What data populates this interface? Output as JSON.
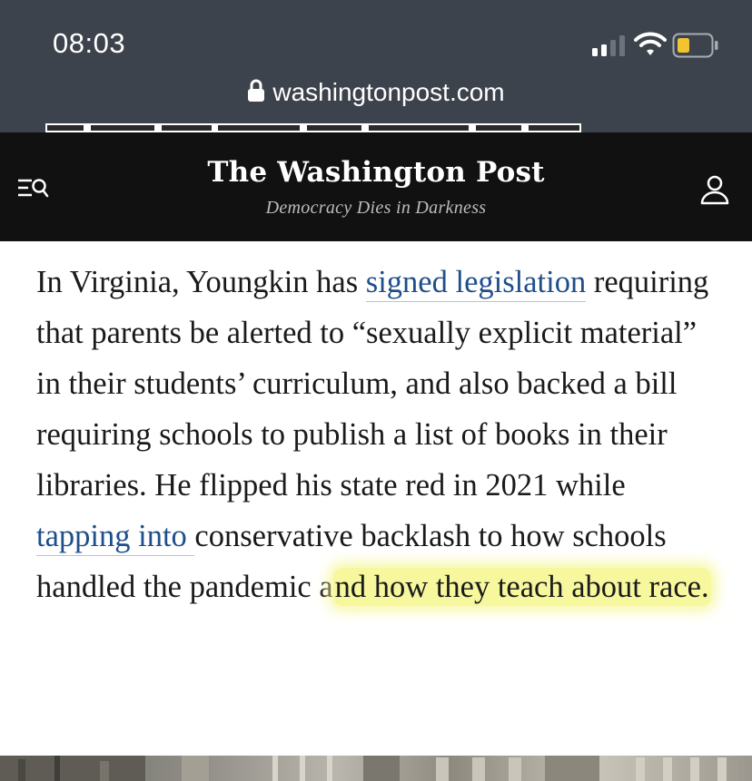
{
  "status_bar": {
    "time": "08:03",
    "signal_icon": "cellular-signal-icon",
    "wifi_icon": "wifi-icon",
    "battery_icon": "battery-low-icon",
    "battery_color": "#f4c430"
  },
  "address_bar": {
    "lock_icon": "lock-icon",
    "url": "washingtonpost.com"
  },
  "header": {
    "menu_icon": "menu-search-icon",
    "masthead": "The Washington Post",
    "tagline": "Democracy Dies in Darkness",
    "profile_icon": "user-profile-icon",
    "background": "#111111"
  },
  "article": {
    "seg1": "In Virginia, Youngkin has ",
    "link1": "signed legislation",
    "seg2": " requiring that parents be alerted to “sexually explicit material” in their students’ curriculum, and also backed a bill requiring schools to publish a list of books in their libraries. He flipped his state red in 2021 while ",
    "link2": "tapping into ",
    "seg3": "conservative backlash to how schools handled the pandemic a",
    "highlighted": "nd how they teach about race.",
    "link_color": "#1f4e8c",
    "highlight_color": "#f6f68c"
  }
}
